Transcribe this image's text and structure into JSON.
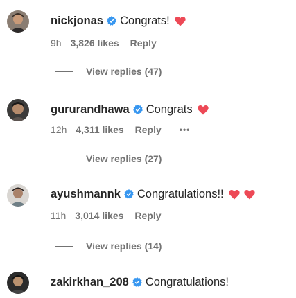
{
  "icons": {
    "verified": "verified-badge-icon",
    "heart": "red-heart-icon",
    "more": "more-options-icon"
  },
  "colors": {
    "verified": "#3897f0",
    "heart": "#ed4956",
    "secondary_text": "#737373"
  },
  "comments": [
    {
      "username": "nickjonas",
      "text": "Congrats!",
      "hearts": 1,
      "time": "9h",
      "likes": "3,826 likes",
      "reply_label": "Reply",
      "more": "",
      "view_replies": "View replies (47)"
    },
    {
      "username": "gururandhawa",
      "text": "Congrats",
      "hearts": 1,
      "time": "12h",
      "likes": "4,311 likes",
      "reply_label": "Reply",
      "more": "•••",
      "view_replies": "View replies (27)"
    },
    {
      "username": "ayushmannk",
      "text": "Congratulations!!",
      "hearts": 2,
      "time": "11h",
      "likes": "3,014 likes",
      "reply_label": "Reply",
      "more": "",
      "view_replies": "View replies (14)"
    },
    {
      "username": "zakirkhan_208",
      "text": "Congratulations!",
      "hearts": 0
    }
  ]
}
